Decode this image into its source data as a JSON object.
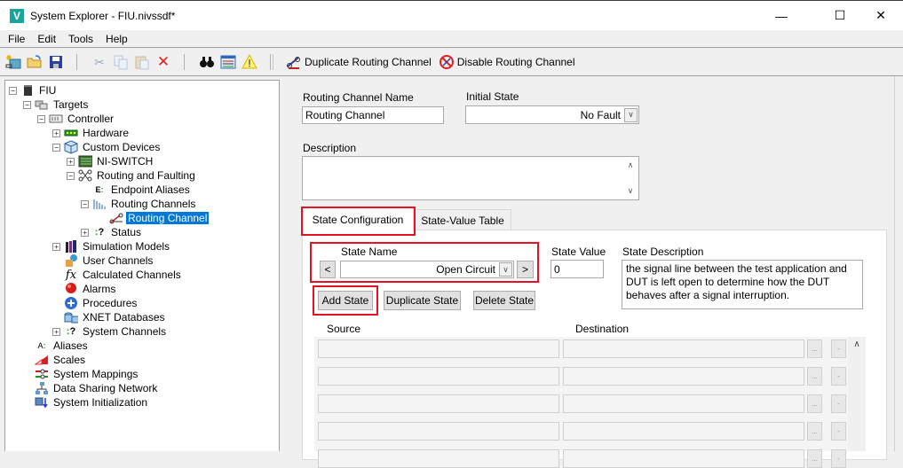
{
  "window": {
    "title": "System Explorer - FIU.nivssdf*",
    "logo_glyph": "V",
    "minimize_glyph": "—",
    "maximize_glyph": "☐",
    "close_glyph": "✕"
  },
  "menu": [
    "File",
    "Edit",
    "Tools",
    "Help"
  ],
  "toolbar": {
    "icons": [
      "new-icon",
      "open-icon",
      "save-icon",
      "cut-icon",
      "copy-icon",
      "paste-icon",
      "delete-icon",
      "find-icon",
      "channel-list-icon",
      "warning-icon"
    ],
    "duplicate_routing_channel": "Duplicate Routing Channel",
    "disable_routing_channel": "Disable Routing Channel"
  },
  "tree": [
    {
      "label": "FIU",
      "level": 0,
      "expander": "−",
      "icon": "fiu-icon"
    },
    {
      "label": "Targets",
      "level": 1,
      "expander": "−",
      "icon": "targets-icon"
    },
    {
      "label": "Controller",
      "level": 2,
      "expander": "−",
      "icon": "controller-icon"
    },
    {
      "label": "Hardware",
      "level": 3,
      "expander": "+",
      "icon": "hardware-icon"
    },
    {
      "label": "Custom Devices",
      "level": 3,
      "expander": "−",
      "icon": "custom-devices-icon"
    },
    {
      "label": "NI-SWITCH",
      "level": 4,
      "expander": "+",
      "icon": "ni-switch-icon"
    },
    {
      "label": "Routing and Faulting",
      "level": 4,
      "expander": "−",
      "icon": "routing-faulting-icon"
    },
    {
      "label": "Endpoint Aliases",
      "level": 5,
      "expander": "",
      "icon": "endpoint-aliases-icon"
    },
    {
      "label": "Routing Channels",
      "level": 5,
      "expander": "−",
      "icon": "routing-channels-icon"
    },
    {
      "label": "Routing Channel",
      "level": 6,
      "expander": "",
      "icon": "routing-channel-icon",
      "selected": true
    },
    {
      "label": "Status",
      "level": 5,
      "expander": "+",
      "icon": "status-icon"
    },
    {
      "label": "Simulation Models",
      "level": 3,
      "expander": "+",
      "icon": "simulation-models-icon"
    },
    {
      "label": "User Channels",
      "level": 3,
      "expander": "",
      "icon": "user-channels-icon"
    },
    {
      "label": "Calculated Channels",
      "level": 3,
      "expander": "",
      "icon": "calculated-channels-icon"
    },
    {
      "label": "Alarms",
      "level": 3,
      "expander": "",
      "icon": "alarms-icon"
    },
    {
      "label": "Procedures",
      "level": 3,
      "expander": "",
      "icon": "procedures-icon"
    },
    {
      "label": "XNET Databases",
      "level": 3,
      "expander": "",
      "icon": "xnet-databases-icon"
    },
    {
      "label": "System Channels",
      "level": 3,
      "expander": "+",
      "icon": "system-channels-icon"
    },
    {
      "label": "Aliases",
      "level": 1,
      "expander": "",
      "icon": "aliases-icon"
    },
    {
      "label": "Scales",
      "level": 1,
      "expander": "",
      "icon": "scales-icon"
    },
    {
      "label": "System Mappings",
      "level": 1,
      "expander": "",
      "icon": "system-mappings-icon"
    },
    {
      "label": "Data Sharing Network",
      "level": 1,
      "expander": "",
      "icon": "data-sharing-network-icon"
    },
    {
      "label": "System Initialization",
      "level": 1,
      "expander": "",
      "icon": "system-initialization-icon"
    }
  ],
  "form": {
    "routing_channel_name_label": "Routing Channel Name",
    "routing_channel_name_value": "Routing Channel",
    "initial_state_label": "Initial State",
    "initial_state_value": "No Fault",
    "description_label": "Description",
    "description_value": ""
  },
  "tabs": [
    {
      "label": "State Configuration",
      "active": true
    },
    {
      "label": "State-Value Table",
      "active": false
    }
  ],
  "state": {
    "state_name_label": "State Name",
    "state_name_value": "Open Circuit",
    "prev_label": "<",
    "next_label": ">",
    "state_value_label": "State Value",
    "state_value": "0",
    "state_description_label": "State Description",
    "state_description_value": "the signal line between the test application and DUT is left open to determine how the DUT behaves after a signal interruption.",
    "add_state": "Add State",
    "duplicate_state": "Duplicate State",
    "delete_state": "Delete State"
  },
  "mapping_grid": {
    "source_header": "Source",
    "destination_header": "Destination",
    "browse_label": "...",
    "remove_label": "-",
    "rows": [
      {
        "source": "",
        "destination": ""
      },
      {
        "source": "",
        "destination": ""
      },
      {
        "source": "",
        "destination": ""
      },
      {
        "source": "",
        "destination": ""
      },
      {
        "source": "",
        "destination": ""
      }
    ]
  },
  "colors": {
    "highlight": "#e81123",
    "selection": "#0078d7",
    "logo": "#1aa59a"
  }
}
